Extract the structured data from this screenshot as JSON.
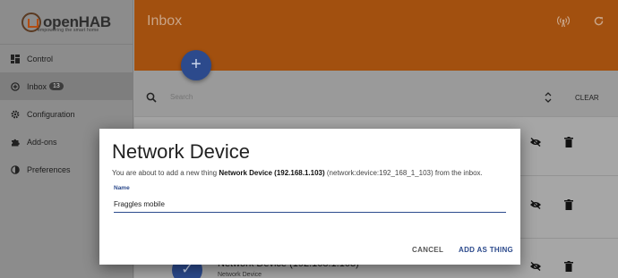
{
  "brand": {
    "name_open": "open",
    "name_hab": "HAB",
    "tagline": "empowering the smart home"
  },
  "sidebar": {
    "items": [
      {
        "label": "Control",
        "icon": "dashboard-icon"
      },
      {
        "label": "Inbox",
        "icon": "add-circle-icon",
        "badge": "13"
      },
      {
        "label": "Configuration",
        "icon": "gear-icon"
      },
      {
        "label": "Add-ons",
        "icon": "puzzle-icon"
      },
      {
        "label": "Preferences",
        "icon": "contrast-icon"
      }
    ]
  },
  "header": {
    "title": "Inbox"
  },
  "search": {
    "placeholder": "Search",
    "clear_label": "CLEAR"
  },
  "background_item": {
    "title": "Network Device (192.168.1.103)",
    "subtitle": "Network Device"
  },
  "dialog": {
    "title": "Network Device",
    "text_prefix": "You are about to add a new thing ",
    "text_bold": "Network Device (192.168.1.103)",
    "text_suffix": " (network:device:192_168_1_103) from the inbox.",
    "field_label": "Name",
    "field_value": "Fraggles mobile",
    "cancel_label": "CANCEL",
    "add_label": "ADD AS THING"
  },
  "colors": {
    "accent": "#2c4a8c",
    "header": "#a2500f",
    "overlay": "#9a9a9a"
  }
}
